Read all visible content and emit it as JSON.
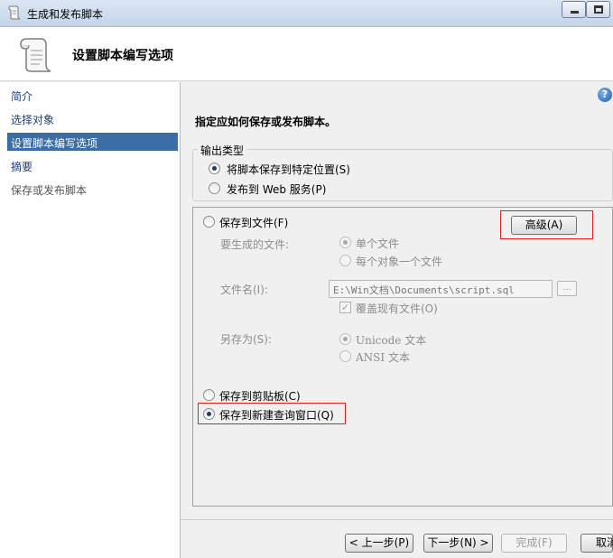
{
  "window": {
    "title": "生成和发布脚本"
  },
  "header": {
    "title": "设置脚本编写选项"
  },
  "sidebar": {
    "items": [
      {
        "label": "简介"
      },
      {
        "label": "选择对象"
      },
      {
        "label": "设置脚本编写选项"
      },
      {
        "label": "摘要"
      },
      {
        "label": "保存或发布脚本"
      }
    ],
    "selected": "设置脚本编写选项"
  },
  "main": {
    "instruction": "指定应如何保存或发布脚本。",
    "output_type": {
      "legend": "输出类型",
      "options": [
        {
          "label": "将脚本保存到特定位置(S)",
          "checked": true
        },
        {
          "label": "发布到 Web 服务(P)",
          "checked": false
        }
      ]
    },
    "save_to_file": {
      "label": "保存到文件(F)",
      "checked": false,
      "advanced_button": "高级(A)",
      "files_to_generate_label": "要生成的文件:",
      "file_options": [
        {
          "label": "单个文件",
          "checked": true
        },
        {
          "label": "每个对象一个文件",
          "checked": false
        }
      ],
      "file_name_label": "文件名(I):",
      "file_name_value": "E:\\Win文档\\Documents\\script.sql",
      "browse_button": "...",
      "overwrite_label": "覆盖现有文件(O)",
      "overwrite_checked": true,
      "save_as_label": "另存为(S):",
      "encoding_options": [
        {
          "label": "Unicode 文本",
          "checked": true
        },
        {
          "label": "ANSI 文本",
          "checked": false
        }
      ]
    },
    "save_to_clipboard": {
      "label": "保存到剪贴板(C)",
      "checked": false
    },
    "save_to_query_window": {
      "label": "保存到新建查询窗口(Q)",
      "checked": true
    }
  },
  "footer": {
    "back_button": "< 上一步(P)",
    "next_button": "下一步(N) >",
    "finish_button": "完成(F)",
    "cancel_button": "取消"
  },
  "colors": {
    "selection": "#3a6ea5",
    "highlight": "#dd2222"
  }
}
